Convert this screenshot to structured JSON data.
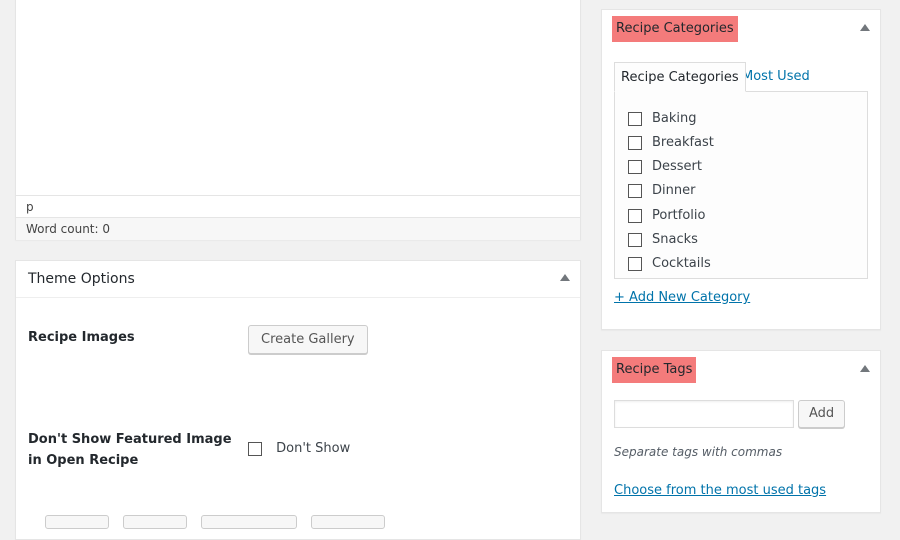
{
  "editor": {
    "path": "p",
    "word_count": "Word count: 0"
  },
  "theme_options": {
    "title": "Theme Options",
    "recipe_images_label": "Recipe Images",
    "create_gallery_label": "Create Gallery",
    "featured_label": "Don't Show Featured Image in Open Recipe",
    "dont_show_label": "Don't Show"
  },
  "categories": {
    "title": "Recipe Categories",
    "tabs": [
      "Recipe Categories",
      "Most Used"
    ],
    "items": [
      "Baking",
      "Breakfast",
      "Dessert",
      "Dinner",
      "Portfolio",
      "Snacks",
      "Cocktails"
    ],
    "add_new": "+ Add New Category"
  },
  "tags": {
    "title": "Recipe Tags",
    "input_value": "",
    "add_label": "Add",
    "hint": "Separate tags with commas",
    "choose_link": "Choose from the most used tags"
  },
  "colors": {
    "highlight": "#f47b7b",
    "link": "#0073aa",
    "background": "#f1f1f1"
  }
}
